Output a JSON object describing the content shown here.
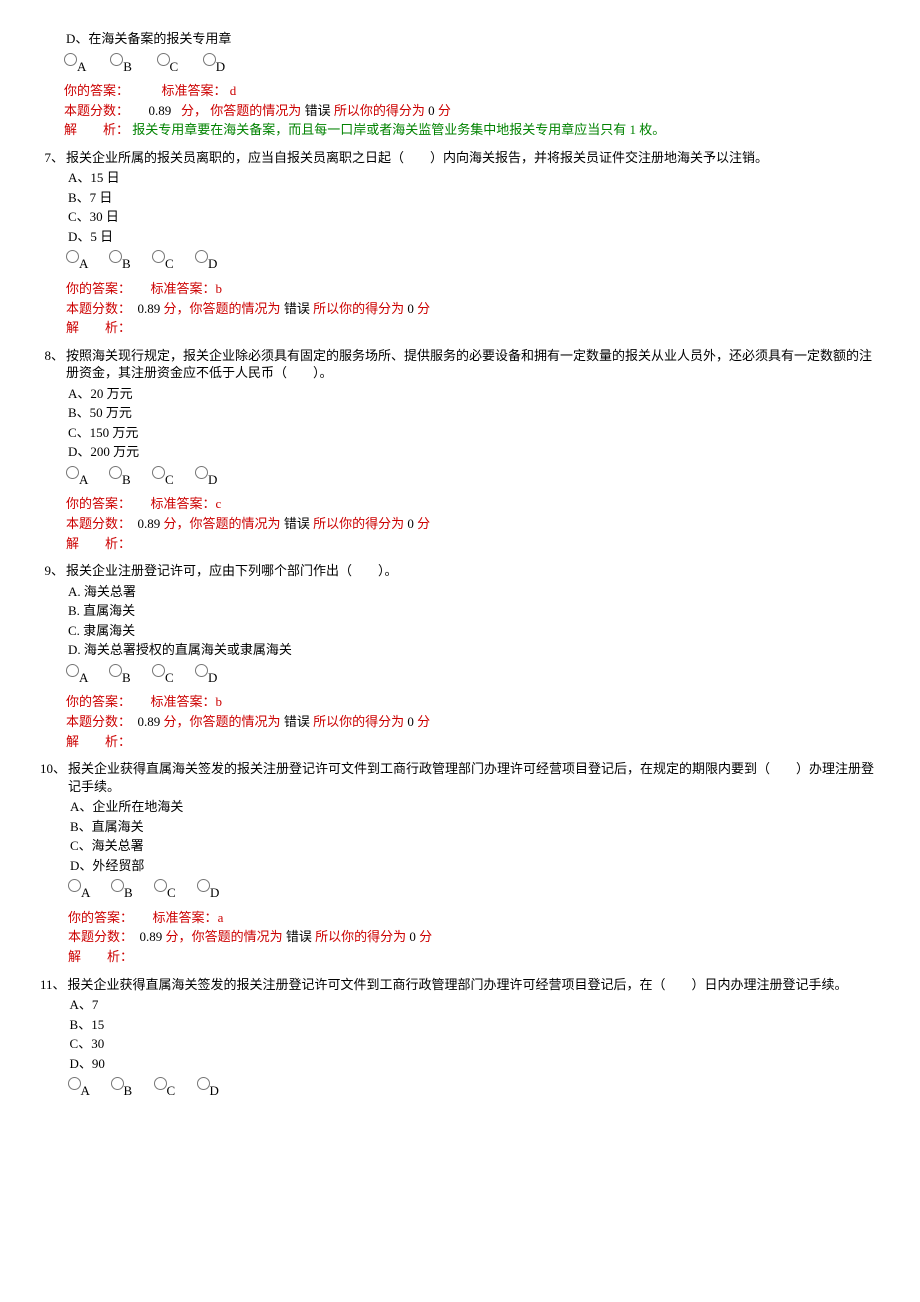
{
  "labels": {
    "your_ans_label": "你的答案：",
    "std_ans_label": "标准答案：",
    "score_label": "本题分数：",
    "score_unit": "分，",
    "situation_label": "你答题的情况为 ",
    "so_score_label": " 所以你的得分为 ",
    "unit_tail": " 分",
    "analysis_label": "解　　析：",
    "radio_A": "A",
    "radio_B": "B",
    "radio_C": "C",
    "radio_D": "D"
  },
  "partial_q6": {
    "optD": "D、在海关备案的报关专用章",
    "std_ans": "d",
    "score": "0.89",
    "result": "错误",
    "got": "0",
    "analysis": "报关专用章要在海关备案，而且每一口岸或者海关监管业务集中地报关专用章应当只有 1 枚。"
  },
  "qs": [
    {
      "num": "7、",
      "stem": "报关企业所属的报关员离职的，应当自报关员离职之日起（　　）内向海关报告，并将报关员证件交注册地海关予以注销。",
      "opts": [
        "A、15 日",
        "B、7 日",
        "C、30 日",
        "D、5 日"
      ],
      "std_ans": "b",
      "score": "0.89",
      "result": "错误",
      "got": "0",
      "analysis": ""
    },
    {
      "num": "8、",
      "stem": "按照海关现行规定，报关企业除必须具有固定的服务场所、提供服务的必要设备和拥有一定数量的报关从业人员外，还必须具有一定数额的注册资金，其注册资金应不低于人民币（　　）。",
      "opts": [
        "A、20 万元",
        "B、50 万元",
        "C、150 万元",
        "D、200 万元"
      ],
      "std_ans": "c",
      "score": "0.89",
      "result": "错误",
      "got": "0",
      "analysis": ""
    },
    {
      "num": "9、",
      "stem": "报关企业注册登记许可，应由下列哪个部门作出（　　）。",
      "opts": [
        "A. 海关总署",
        "B. 直属海关",
        "C. 隶属海关",
        "D. 海关总署授权的直属海关或隶属海关"
      ],
      "std_ans": "b",
      "score": "0.89",
      "result": "错误",
      "got": "0",
      "analysis": ""
    },
    {
      "num": "10、",
      "stem": "报关企业获得直属海关签发的报关注册登记许可文件到工商行政管理部门办理许可经营项目登记后，在规定的期限内要到（　　）办理注册登记手续。",
      "opts": [
        "A、企业所在地海关",
        "B、直属海关",
        "C、海关总署",
        "D、外经贸部"
      ],
      "std_ans": "a",
      "score": "0.89",
      "result": "错误",
      "got": "0",
      "analysis": ""
    },
    {
      "num": "11、",
      "stem": "报关企业获得直属海关签发的报关注册登记许可文件到工商行政管理部门办理许可经营项目登记后，在（　　）日内办理注册登记手续。",
      "opts": [
        "A、7",
        "B、15",
        "C、30",
        "D、90"
      ],
      "std_ans": "",
      "score": "",
      "result": "",
      "got": "",
      "analysis": null
    }
  ]
}
